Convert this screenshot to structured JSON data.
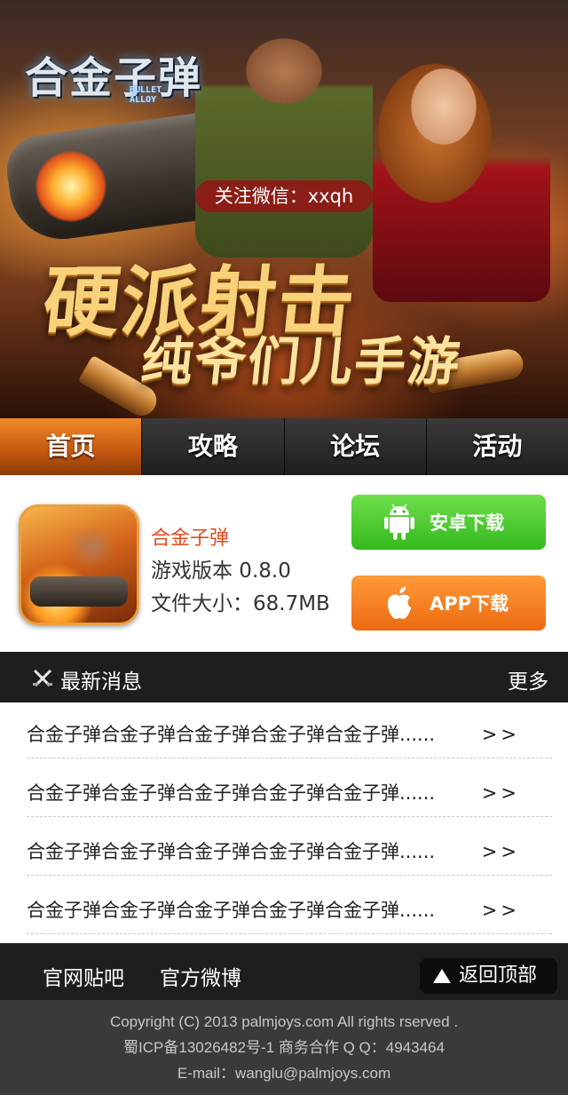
{
  "hero": {
    "logo_text": "合金子弹",
    "logo_sub_1": "BULLET",
    "logo_sub_2": "ALLOY",
    "wechat": "关注微信：xxqh",
    "slogan_1": "硬派射击",
    "slogan_2": "纯爷们儿手游"
  },
  "nav": {
    "tabs": [
      {
        "label": "首页",
        "active": true
      },
      {
        "label": "攻略"
      },
      {
        "label": "论坛"
      },
      {
        "label": "活动"
      }
    ]
  },
  "app": {
    "name": "合金子弹",
    "version": "游戏版本 0.8.0",
    "size": "文件大小：68.7MB",
    "android_button": "安卓下载",
    "ios_button": "APP下载",
    "colors": {
      "android": "#35b81e",
      "ios": "#ec6a10",
      "name": "#e24a1a"
    }
  },
  "news": {
    "title": "最新消息",
    "more": "更多",
    "items": [
      {
        "text": "合金子弹合金子弹合金子弹合金子弹合金子弹......",
        "arrow": ">>"
      },
      {
        "text": "合金子弹合金子弹合金子弹合金子弹合金子弹......",
        "arrow": ">>"
      },
      {
        "text": "合金子弹合金子弹合金子弹合金子弹合金子弹......",
        "arrow": ">>"
      },
      {
        "text": "合金子弹合金子弹合金子弹合金子弹合金子弹......",
        "arrow": ">>"
      }
    ]
  },
  "footer": {
    "link_tieba": "官网贴吧",
    "link_weibo": "官方微博",
    "back_to_top": "返回顶部",
    "copyright": "Copyright (C) 2013 palmjoys.com All rights rserved .",
    "icp": "蜀ICP备13026482号-1   商务合作 Q Q：4943464",
    "email": "E-mail：wanglu@palmjoys.com"
  }
}
